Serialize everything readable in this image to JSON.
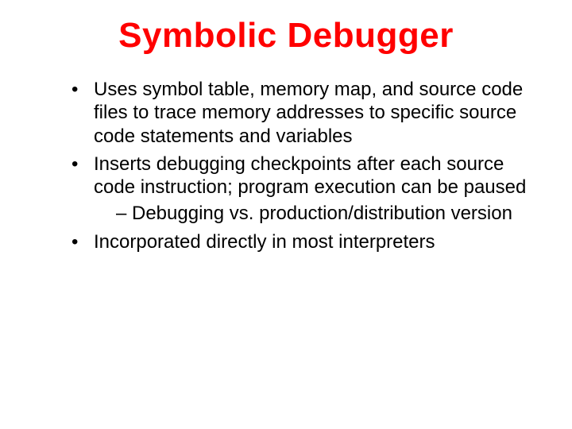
{
  "title": "Symbolic Debugger",
  "bullets": {
    "b1": "Uses symbol table, memory map, and source code files to trace memory addresses to specific source code statements and variables",
    "b2": "Inserts debugging checkpoints after each source code instruction; program execution can be paused",
    "b2_sub1": "Debugging vs. production/distribution version",
    "b3": "Incorporated directly in most interpreters"
  }
}
